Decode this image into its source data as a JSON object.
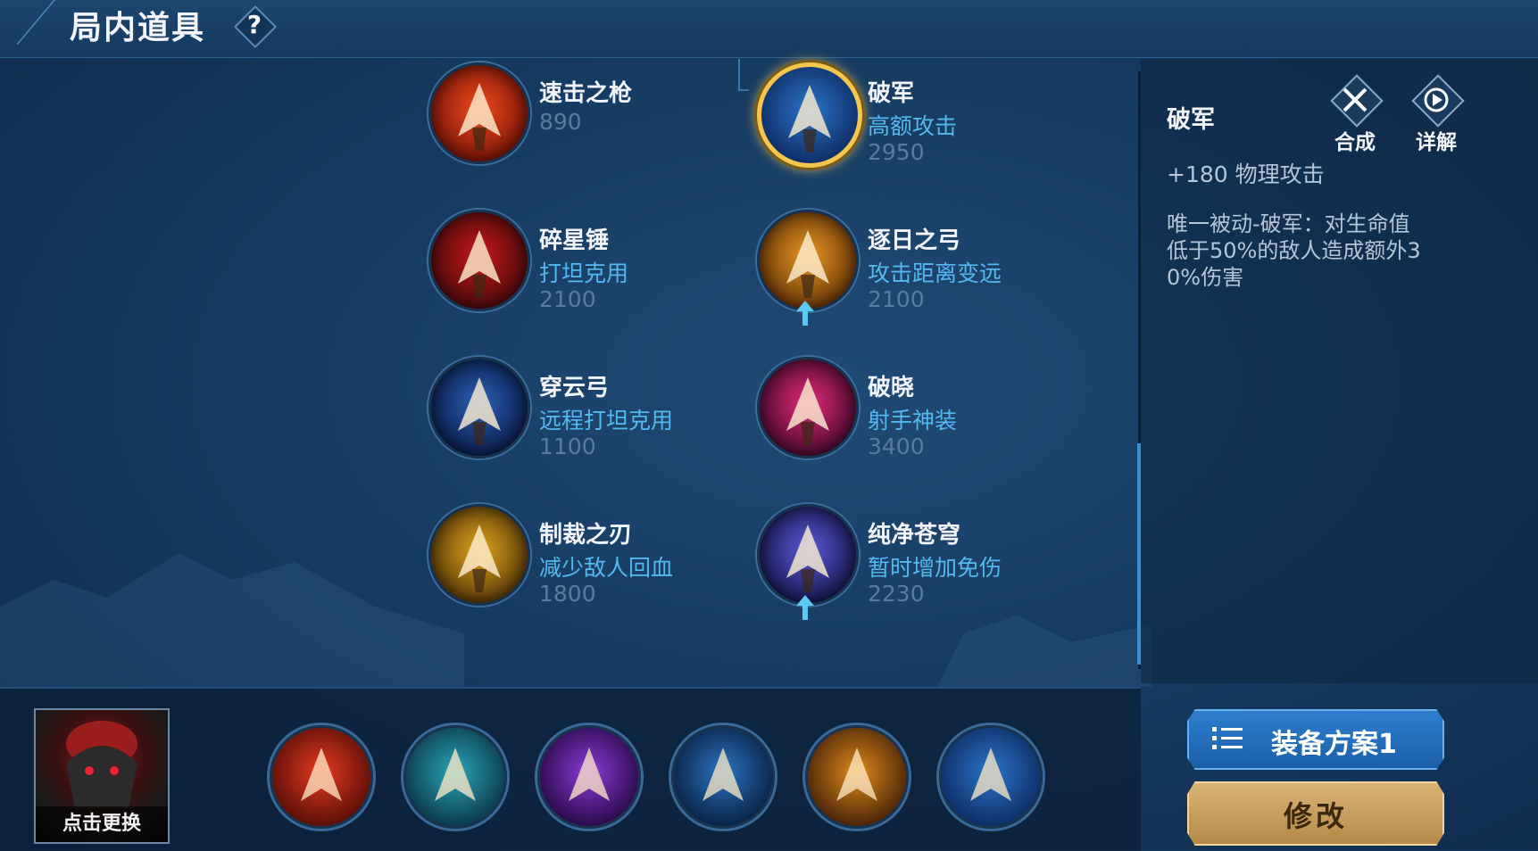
{
  "header": {
    "title": "局内道具",
    "help_glyph": "?"
  },
  "items": [
    {
      "name": "速击之枪",
      "tag": "",
      "price": "890",
      "icon": "spear-icon",
      "colors": [
        "#f04a1c",
        "#7a1508"
      ],
      "selected": false,
      "upgrade": false
    },
    {
      "name": "破军",
      "tag": "高额攻击",
      "price": "2950",
      "icon": "trident-icon",
      "colors": [
        "#2b74c8",
        "#0e2e66"
      ],
      "selected": true,
      "upgrade": false
    },
    {
      "name": "碎星锤",
      "tag": "打坦克用",
      "price": "2100",
      "icon": "hammer-icon",
      "colors": [
        "#c6181c",
        "#4b0a0a"
      ],
      "selected": false,
      "upgrade": false
    },
    {
      "name": "逐日之弓",
      "tag": "攻击距离变远",
      "price": "2100",
      "icon": "bow-icon",
      "colors": [
        "#e69722",
        "#6a3608"
      ],
      "selected": false,
      "upgrade": true
    },
    {
      "name": "穿云弓",
      "tag": "远程打坦克用",
      "price": "1100",
      "icon": "crossbow-icon",
      "colors": [
        "#2d60b8",
        "#0a1c4a"
      ],
      "selected": false,
      "upgrade": false
    },
    {
      "name": "破晓",
      "tag": "射手神装",
      "price": "3400",
      "icon": "dawn-crossbow-icon",
      "colors": [
        "#e0287a",
        "#4a0a2e"
      ],
      "selected": false,
      "upgrade": false
    },
    {
      "name": "制裁之刃",
      "tag": "减少敌人回血",
      "price": "1800",
      "icon": "blade-icon",
      "colors": [
        "#e0a41c",
        "#5a3a08"
      ],
      "selected": false,
      "upgrade": false
    },
    {
      "name": "纯净苍穹",
      "tag": "暂时增加免伤",
      "price": "2230",
      "icon": "sky-sword-icon",
      "colors": [
        "#5a5ad8",
        "#16164e"
      ],
      "selected": false,
      "upgrade": true
    }
  ],
  "detail": {
    "name": "破军",
    "synth_label": "合成",
    "info_label": "详解",
    "stat": "+180 物理攻击",
    "desc_lines": [
      "唯一被动-破军：对生命值",
      "低于50%的敌人造成额外3",
      "0%伤害"
    ]
  },
  "loadout": [
    {
      "icon": "equip-slot-1-icon",
      "colors": [
        "#e53a1e",
        "#5a0f08"
      ]
    },
    {
      "icon": "boots-icon",
      "colors": [
        "#2aa5b8",
        "#0b3a4a"
      ]
    },
    {
      "icon": "axe-icon",
      "colors": [
        "#8a3ad6",
        "#2a0a4a"
      ]
    },
    {
      "icon": "sun-blade-icon",
      "colors": [
        "#2a74c2",
        "#0a2246"
      ]
    },
    {
      "icon": "dragon-blade-icon",
      "colors": [
        "#e08a1c",
        "#4a2408"
      ]
    },
    {
      "icon": "trident-icon",
      "colors": [
        "#2b74c8",
        "#0e2e66"
      ]
    }
  ],
  "hero": {
    "caption": "点击更换"
  },
  "buttons": {
    "plan_label": "装备方案1",
    "modify_label": "修改"
  },
  "colors": {
    "accent_blue": "#54b9f1",
    "gold": "#f5c64e",
    "price_gray": "#5a7b9d"
  }
}
